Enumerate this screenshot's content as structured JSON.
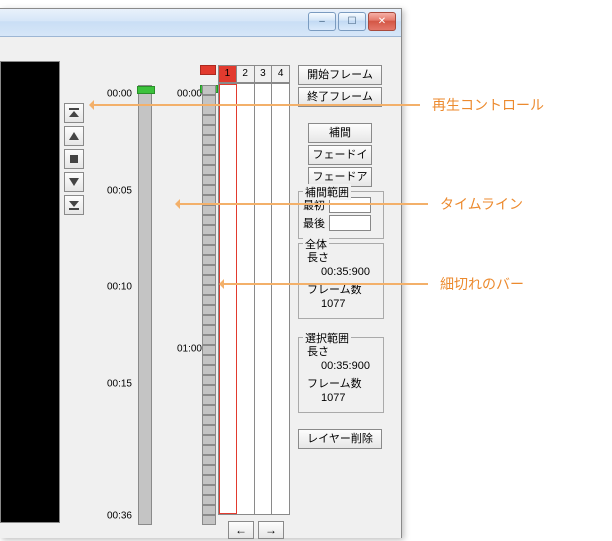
{
  "window": {
    "btns": {
      "min": "–",
      "max": "☐",
      "close": "✕"
    }
  },
  "timeline_a": {
    "labels": [
      "00:00",
      "00:05",
      "00:10",
      "00:15",
      "00:36"
    ]
  },
  "timeline_b": {
    "labels": [
      "00:00",
      "01:00"
    ]
  },
  "layers": {
    "headers": [
      "1",
      "2",
      "3",
      "4"
    ],
    "selected": 1,
    "nav_prev": "←",
    "nav_next": "→"
  },
  "side": {
    "btn_start_frame": "開始フレーム",
    "btn_end_frame": "終了フレーム",
    "btn_interp": "補間",
    "btn_fadein": "フェードイン",
    "btn_fadeout": "フェードアウト",
    "group_interp_range": {
      "legend": "補間範囲",
      "first_label": "最初",
      "first_value": "",
      "last_label": "最後",
      "last_value": ""
    },
    "group_all": {
      "legend": "全体",
      "length_label": "長さ",
      "length_value": "00:35:900",
      "frames_label": "フレーム数",
      "frames_value": "1077"
    },
    "group_sel": {
      "legend": "選択範囲",
      "length_label": "長さ",
      "length_value": "00:35:900",
      "frames_label": "フレーム数",
      "frames_value": "1077"
    },
    "btn_delete_layer": "レイヤー削除"
  },
  "annotations": {
    "a1": "再生コントロール",
    "a2": "タイムライン",
    "a3": "細切れのバー"
  },
  "icons": {
    "top": "top",
    "up": "up",
    "stop": "stop",
    "down": "down",
    "bottom": "bottom"
  }
}
